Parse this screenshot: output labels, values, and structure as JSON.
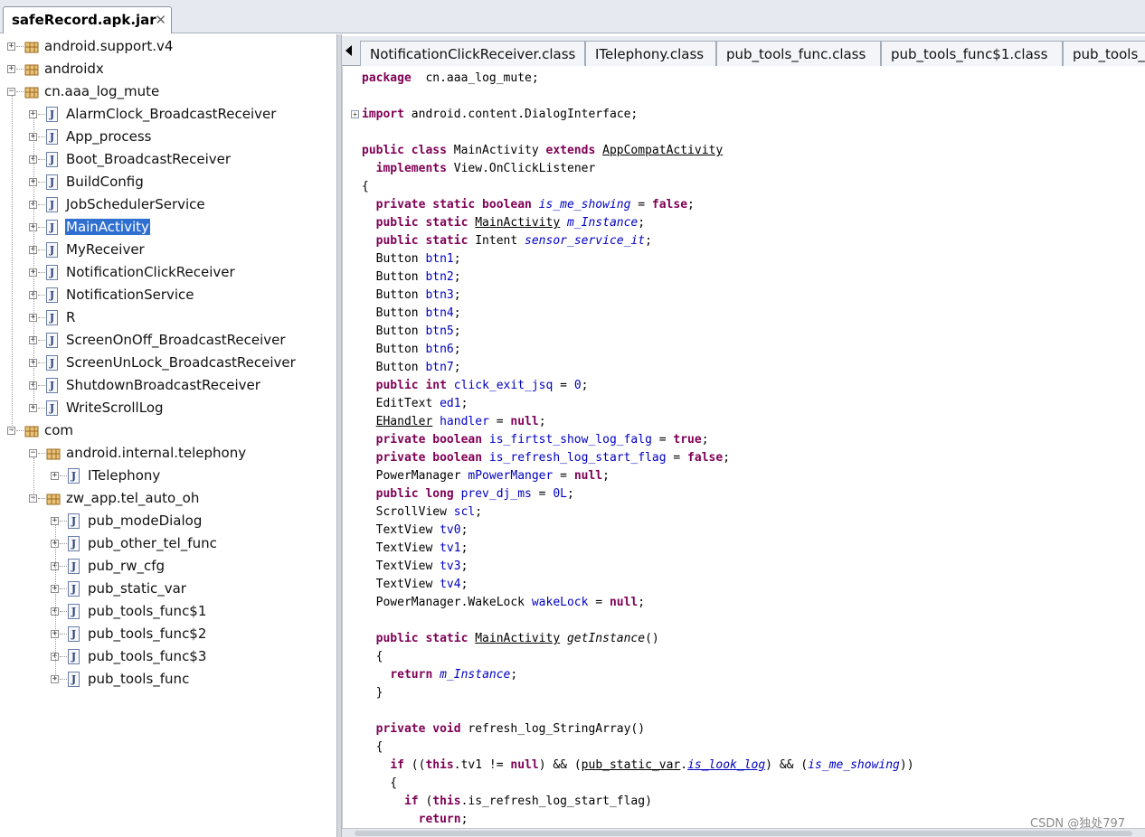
{
  "file_tab": {
    "label": "safeRecord.apk.jar",
    "close_glyph": "✕"
  },
  "tree": [
    {
      "label": "android.support.v4",
      "icon": "package-icon",
      "expand": "+"
    },
    {
      "label": "androidx",
      "icon": "package-icon",
      "expand": "+"
    },
    {
      "label": "cn.aaa_log_mute",
      "icon": "package-icon",
      "expand": "−"
    },
    {
      "label": "AlarmClock_BroadcastReceiver",
      "icon": "class-file-icon",
      "expand": "+"
    },
    {
      "label": "App_process",
      "icon": "class-file-icon",
      "expand": "+"
    },
    {
      "label": "Boot_BroadcastReceiver",
      "icon": "class-file-icon",
      "expand": "+"
    },
    {
      "label": "BuildConfig",
      "icon": "class-file-icon",
      "expand": "+"
    },
    {
      "label": "JobSchedulerService",
      "icon": "class-file-icon",
      "expand": "+"
    },
    {
      "label": "MainActivity",
      "icon": "class-file-icon",
      "expand": "+",
      "selected": true
    },
    {
      "label": "MyReceiver",
      "icon": "class-file-icon",
      "expand": "+"
    },
    {
      "label": "NotificationClickReceiver",
      "icon": "class-file-icon",
      "expand": "+"
    },
    {
      "label": "NotificationService",
      "icon": "class-file-icon",
      "expand": "+"
    },
    {
      "label": "R",
      "icon": "class-file-icon",
      "expand": "+"
    },
    {
      "label": "ScreenOnOff_BroadcastReceiver",
      "icon": "class-file-icon",
      "expand": "+"
    },
    {
      "label": "ScreenUnLock_BroadcastReceiver",
      "icon": "class-file-icon",
      "expand": "+"
    },
    {
      "label": "ShutdownBroadcastReceiver",
      "icon": "class-file-icon",
      "expand": "+"
    },
    {
      "label": "WriteScrollLog",
      "icon": "class-file-icon",
      "expand": "+"
    },
    {
      "label": "com",
      "icon": "package-icon",
      "expand": "−"
    },
    {
      "label": "android.internal.telephony",
      "icon": "package-icon",
      "expand": "−"
    },
    {
      "label": "ITelephony",
      "icon": "class-file-icon",
      "expand": "+"
    },
    {
      "label": "zw_app.tel_auto_oh",
      "icon": "package-icon",
      "expand": "−"
    },
    {
      "label": "pub_modeDialog",
      "icon": "class-file-icon",
      "expand": "+"
    },
    {
      "label": "pub_other_tel_func",
      "icon": "class-file-icon",
      "expand": "+"
    },
    {
      "label": "pub_rw_cfg",
      "icon": "class-file-icon",
      "expand": "+"
    },
    {
      "label": "pub_static_var",
      "icon": "class-file-icon",
      "expand": "+"
    },
    {
      "label": "pub_tools_func$1",
      "icon": "class-file-icon",
      "expand": "+"
    },
    {
      "label": "pub_tools_func$2",
      "icon": "class-file-icon",
      "expand": "+"
    },
    {
      "label": "pub_tools_func$3",
      "icon": "class-file-icon",
      "expand": "+"
    },
    {
      "label": "pub_tools_func",
      "icon": "class-file-icon",
      "expand": "+"
    }
  ],
  "editor_tabs": [
    {
      "label": "NotificationClickReceiver.class"
    },
    {
      "label": "ITelephony.class"
    },
    {
      "label": "pub_tools_func.class"
    },
    {
      "label": "pub_tools_func$1.class"
    },
    {
      "label": "pub_tools_f"
    }
  ],
  "code_lines": [
    [
      [
        "kw",
        "package"
      ],
      [
        "",
        "  cn.aaa_log_mute;"
      ]
    ],
    [],
    [
      [
        "kw",
        "import"
      ],
      [
        "",
        " android.content.DialogInterface;"
      ]
    ],
    [],
    [
      [
        "kw",
        "public class"
      ],
      [
        "",
        " MainActivity "
      ],
      [
        "kw",
        "extends"
      ],
      [
        "",
        " "
      ],
      [
        "ul",
        "AppCompatActivity"
      ]
    ],
    [
      [
        "",
        "  "
      ],
      [
        "kw",
        "implements"
      ],
      [
        "",
        " View.OnClickListener"
      ]
    ],
    [
      [
        "",
        "{"
      ]
    ],
    [
      [
        "",
        "  "
      ],
      [
        "kw",
        "private static boolean"
      ],
      [
        "",
        " "
      ],
      [
        "fld it",
        "is_me_showing"
      ],
      [
        "",
        " = "
      ],
      [
        "kw",
        "false"
      ],
      [
        "",
        ";"
      ]
    ],
    [
      [
        "",
        "  "
      ],
      [
        "kw",
        "public static"
      ],
      [
        "",
        " "
      ],
      [
        "ul",
        "MainActivity"
      ],
      [
        "",
        " "
      ],
      [
        "fld it",
        "m_Instance"
      ],
      [
        "",
        ";"
      ]
    ],
    [
      [
        "",
        "  "
      ],
      [
        "kw",
        "public static"
      ],
      [
        "",
        " Intent "
      ],
      [
        "fld it",
        "sensor_service_it"
      ],
      [
        "",
        ";"
      ]
    ],
    [
      [
        "",
        "  Button "
      ],
      [
        "fld",
        "btn1"
      ],
      [
        "",
        ";"
      ]
    ],
    [
      [
        "",
        "  Button "
      ],
      [
        "fld",
        "btn2"
      ],
      [
        "",
        ";"
      ]
    ],
    [
      [
        "",
        "  Button "
      ],
      [
        "fld",
        "btn3"
      ],
      [
        "",
        ";"
      ]
    ],
    [
      [
        "",
        "  Button "
      ],
      [
        "fld",
        "btn4"
      ],
      [
        "",
        ";"
      ]
    ],
    [
      [
        "",
        "  Button "
      ],
      [
        "fld",
        "btn5"
      ],
      [
        "",
        ";"
      ]
    ],
    [
      [
        "",
        "  Button "
      ],
      [
        "fld",
        "btn6"
      ],
      [
        "",
        ";"
      ]
    ],
    [
      [
        "",
        "  Button "
      ],
      [
        "fld",
        "btn7"
      ],
      [
        "",
        ";"
      ]
    ],
    [
      [
        "",
        "  "
      ],
      [
        "kw",
        "public int"
      ],
      [
        "",
        " "
      ],
      [
        "fld",
        "click_exit_jsq"
      ],
      [
        "",
        " = "
      ],
      [
        "fld",
        "0"
      ],
      [
        "",
        ";"
      ]
    ],
    [
      [
        "",
        "  EditText "
      ],
      [
        "fld",
        "ed1"
      ],
      [
        "",
        ";"
      ]
    ],
    [
      [
        "",
        "  "
      ],
      [
        "ul",
        "EHandler"
      ],
      [
        "",
        " "
      ],
      [
        "fld",
        "handler"
      ],
      [
        "",
        " = "
      ],
      [
        "kw",
        "null"
      ],
      [
        "",
        ";"
      ]
    ],
    [
      [
        "",
        "  "
      ],
      [
        "kw",
        "private boolean"
      ],
      [
        "",
        " "
      ],
      [
        "fld",
        "is_firtst_show_log_falg"
      ],
      [
        "",
        " = "
      ],
      [
        "kw",
        "true"
      ],
      [
        "",
        ";"
      ]
    ],
    [
      [
        "",
        "  "
      ],
      [
        "kw",
        "private boolean"
      ],
      [
        "",
        " "
      ],
      [
        "fld",
        "is_refresh_log_start_flag"
      ],
      [
        "",
        " = "
      ],
      [
        "kw",
        "false"
      ],
      [
        "",
        ";"
      ]
    ],
    [
      [
        "",
        "  PowerManager "
      ],
      [
        "fld",
        "mPowerManger"
      ],
      [
        "",
        " = "
      ],
      [
        "kw",
        "null"
      ],
      [
        "",
        ";"
      ]
    ],
    [
      [
        "",
        "  "
      ],
      [
        "kw",
        "public long"
      ],
      [
        "",
        " "
      ],
      [
        "fld",
        "prev_dj_ms"
      ],
      [
        "",
        " = "
      ],
      [
        "fld",
        "0L"
      ],
      [
        "",
        ";"
      ]
    ],
    [
      [
        "",
        "  ScrollView "
      ],
      [
        "fld",
        "scl"
      ],
      [
        "",
        ";"
      ]
    ],
    [
      [
        "",
        "  TextView "
      ],
      [
        "fld",
        "tv0"
      ],
      [
        "",
        ";"
      ]
    ],
    [
      [
        "",
        "  TextView "
      ],
      [
        "fld",
        "tv1"
      ],
      [
        "",
        ";"
      ]
    ],
    [
      [
        "",
        "  TextView "
      ],
      [
        "fld",
        "tv3"
      ],
      [
        "",
        ";"
      ]
    ],
    [
      [
        "",
        "  TextView "
      ],
      [
        "fld",
        "tv4"
      ],
      [
        "",
        ";"
      ]
    ],
    [
      [
        "",
        "  PowerManager.WakeLock "
      ],
      [
        "fld",
        "wakeLock"
      ],
      [
        "",
        " = "
      ],
      [
        "kw",
        "null"
      ],
      [
        "",
        ";"
      ]
    ],
    [],
    [
      [
        "",
        "  "
      ],
      [
        "kw",
        "public static"
      ],
      [
        "",
        " "
      ],
      [
        "ul",
        "MainActivity"
      ],
      [
        "",
        " "
      ],
      [
        "it",
        "getInstance"
      ],
      [
        "",
        "()"
      ]
    ],
    [
      [
        "",
        "  {"
      ]
    ],
    [
      [
        "",
        "    "
      ],
      [
        "kw",
        "return"
      ],
      [
        "",
        " "
      ],
      [
        "fld it",
        "m_Instance"
      ],
      [
        "",
        ";"
      ]
    ],
    [
      [
        "",
        "  }"
      ]
    ],
    [],
    [
      [
        "",
        "  "
      ],
      [
        "kw",
        "private void"
      ],
      [
        "",
        " refresh_log_StringArray()"
      ]
    ],
    [
      [
        "",
        "  {"
      ]
    ],
    [
      [
        "",
        "    "
      ],
      [
        "kw",
        "if"
      ],
      [
        "",
        " (("
      ],
      [
        "kw",
        "this"
      ],
      [
        "",
        ".tv1 != "
      ],
      [
        "kw",
        "null"
      ],
      [
        "",
        ") && ("
      ],
      [
        "ul",
        "pub_static_var"
      ],
      [
        "",
        "."
      ],
      [
        "fld it ul",
        "is_look_log"
      ],
      [
        "",
        ") && ("
      ],
      [
        "fld it",
        "is_me_showing"
      ],
      [
        "",
        "))"
      ]
    ],
    [
      [
        "",
        "    {"
      ]
    ],
    [
      [
        "",
        "      "
      ],
      [
        "kw",
        "if"
      ],
      [
        "",
        " ("
      ],
      [
        "kw",
        "this"
      ],
      [
        "",
        ".is_refresh_log_start_flag)"
      ]
    ],
    [
      [
        "",
        "        "
      ],
      [
        "kw",
        "return"
      ],
      [
        "",
        ";"
      ]
    ]
  ],
  "watermark": "CSDN @独处797"
}
